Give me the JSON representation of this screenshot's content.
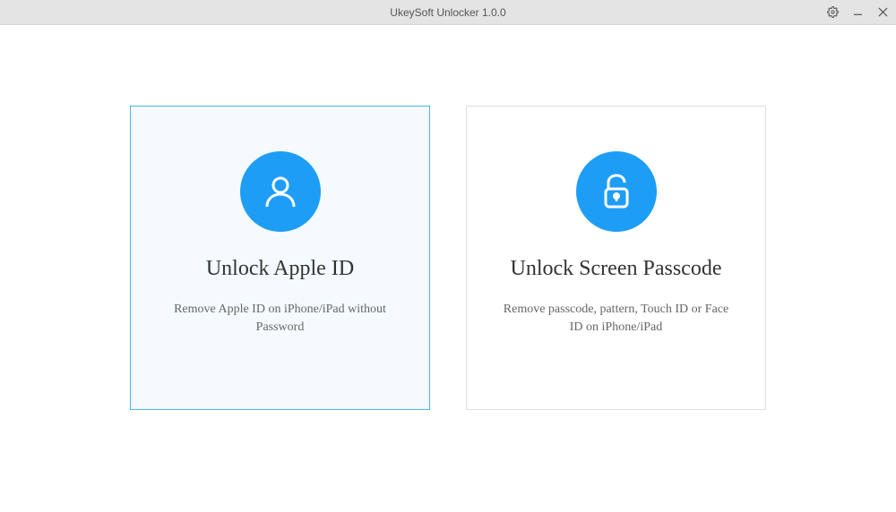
{
  "titlebar": {
    "title": "UkeySoft Unlocker 1.0.0"
  },
  "options": {
    "appleId": {
      "title": "Unlock Apple ID",
      "description": "Remove Apple ID on iPhone/iPad without Password"
    },
    "screenPasscode": {
      "title": "Unlock Screen Passcode",
      "description": "Remove passcode, pattern, Touch ID or Face ID on iPhone/iPad"
    }
  }
}
